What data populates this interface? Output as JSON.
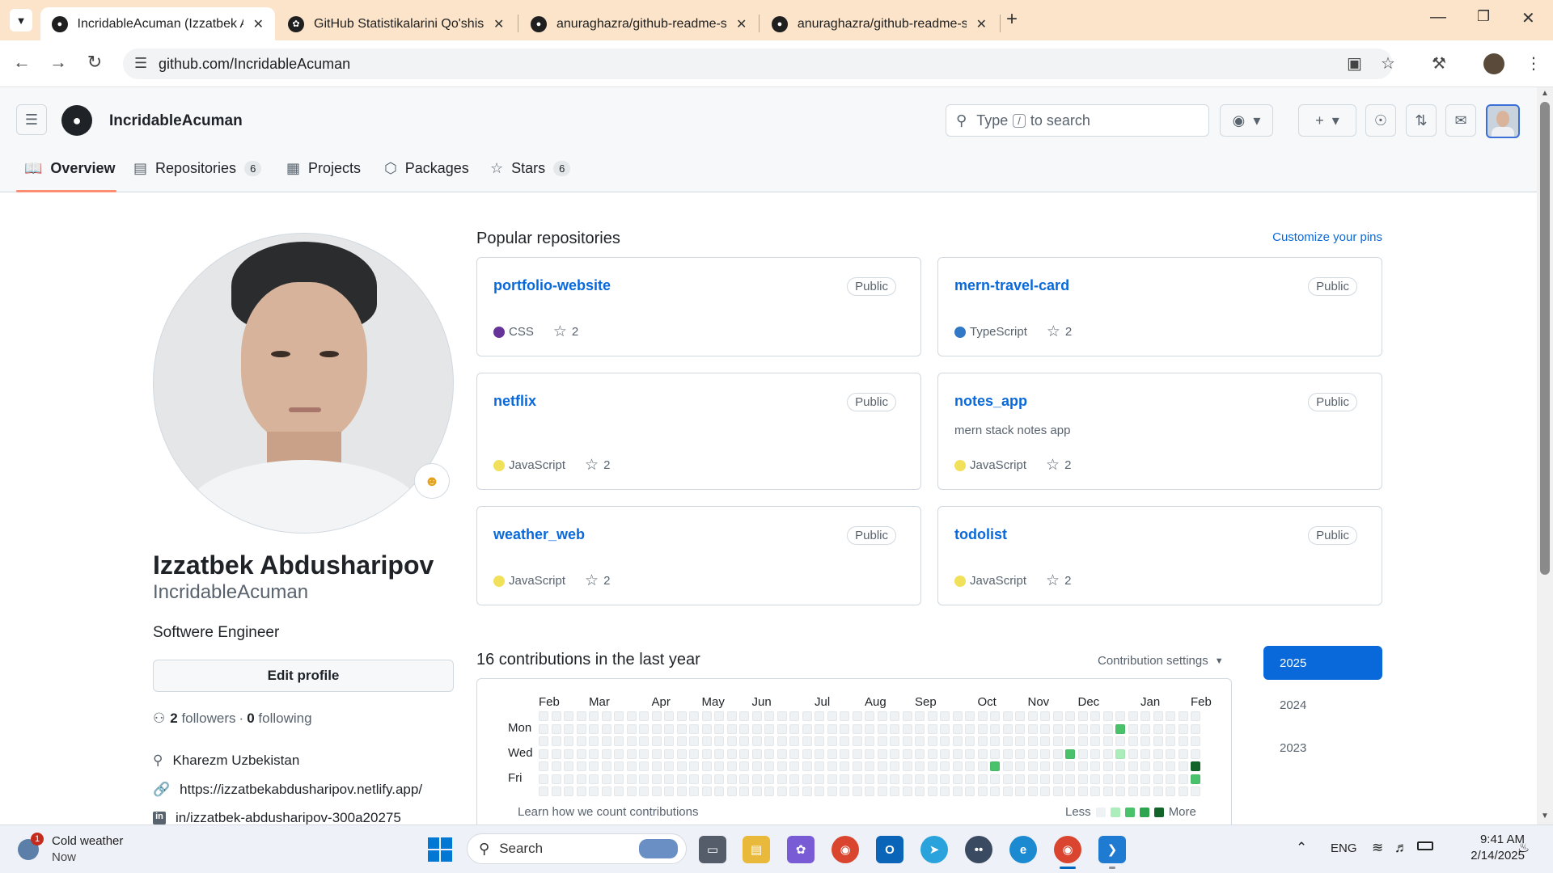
{
  "browser": {
    "tabs": [
      {
        "title": "IncridableAcuman (Izzatbek Ab",
        "icon": "github-icon",
        "active": true
      },
      {
        "title": "GitHub Statistikalarini Qo'shish",
        "icon": "chatgpt-icon",
        "active": false
      },
      {
        "title": "anuraghazra/github-readme-st",
        "icon": "github-icon",
        "active": false
      },
      {
        "title": "anuraghazra/github-readme-st",
        "icon": "github-icon",
        "active": false
      }
    ],
    "url": "github.com/IncridableAcuman"
  },
  "header": {
    "username": "IncridableAcuman",
    "search_prefix": "Type",
    "search_key": "/",
    "search_suffix": "to search"
  },
  "nav": {
    "tabs": [
      {
        "label": "Overview",
        "icon": "book-icon",
        "count": ""
      },
      {
        "label": "Repositories",
        "icon": "repo-icon",
        "count": "6"
      },
      {
        "label": "Projects",
        "icon": "table-icon",
        "count": ""
      },
      {
        "label": "Packages",
        "icon": "package-icon",
        "count": ""
      },
      {
        "label": "Stars",
        "icon": "star-icon",
        "count": "6"
      }
    ]
  },
  "profile": {
    "fullname": "Izzatbek Abdusharipov",
    "login": "IncridableAcuman",
    "bio": "Softwere Engineer",
    "edit_label": "Edit profile",
    "followers": "2",
    "followers_label": "followers",
    "following": "0",
    "following_label": "following",
    "location": "Kharezm Uzbekistan",
    "website": "https://izzatbekabdusharipov.netlify.app/",
    "linkedin": "in/izzatbek-abdusharipov-300a20275"
  },
  "popular": {
    "heading": "Popular repositories",
    "customize": "Customize your pins",
    "repos": [
      {
        "name": "portfolio-website",
        "visibility": "Public",
        "desc": "",
        "lang": "CSS",
        "lang_color": "#663399",
        "stars": "2"
      },
      {
        "name": "mern-travel-card",
        "visibility": "Public",
        "desc": "",
        "lang": "TypeScript",
        "lang_color": "#3178c6",
        "stars": "2"
      },
      {
        "name": "netflix",
        "visibility": "Public",
        "desc": "",
        "lang": "JavaScript",
        "lang_color": "#f1e05a",
        "stars": "2"
      },
      {
        "name": "notes_app",
        "visibility": "Public",
        "desc": "mern stack notes app",
        "lang": "JavaScript",
        "lang_color": "#f1e05a",
        "stars": "2"
      },
      {
        "name": "weather_web",
        "visibility": "Public",
        "desc": "",
        "lang": "JavaScript",
        "lang_color": "#f1e05a",
        "stars": "2"
      },
      {
        "name": "todolist",
        "visibility": "Public",
        "desc": "",
        "lang": "JavaScript",
        "lang_color": "#f1e05a",
        "stars": "2"
      }
    ]
  },
  "contrib": {
    "heading": "16 contributions in the last year",
    "settings": "Contribution settings",
    "months": [
      "Feb",
      "Mar",
      "Apr",
      "May",
      "Jun",
      "Jul",
      "Aug",
      "Sep",
      "Oct",
      "Nov",
      "Dec",
      "Jan",
      "Feb"
    ],
    "days": [
      "Mon",
      "Wed",
      "Fri"
    ],
    "learn": "Learn how we count contributions",
    "less": "Less",
    "more": "More",
    "years": [
      "2025",
      "2024",
      "2023"
    ],
    "colors": [
      "#eff2f5",
      "#aceebb",
      "#4ac26b",
      "#2da44e",
      "#116329"
    ],
    "active_cells": [
      {
        "week": 36,
        "day": 4,
        "level": 2
      },
      {
        "week": 42,
        "day": 3,
        "level": 2
      },
      {
        "week": 46,
        "day": 1,
        "level": 2
      },
      {
        "week": 46,
        "day": 3,
        "level": 1
      },
      {
        "week": 52,
        "day": 4,
        "level": 4
      },
      {
        "week": 52,
        "day": 5,
        "level": 2
      }
    ]
  },
  "taskbar": {
    "weather_title": "Cold weather",
    "weather_sub": "Now",
    "weather_badge": "1",
    "search": "Search",
    "lang": "ENG",
    "time": "9:41 AM",
    "date": "2/14/2025"
  }
}
